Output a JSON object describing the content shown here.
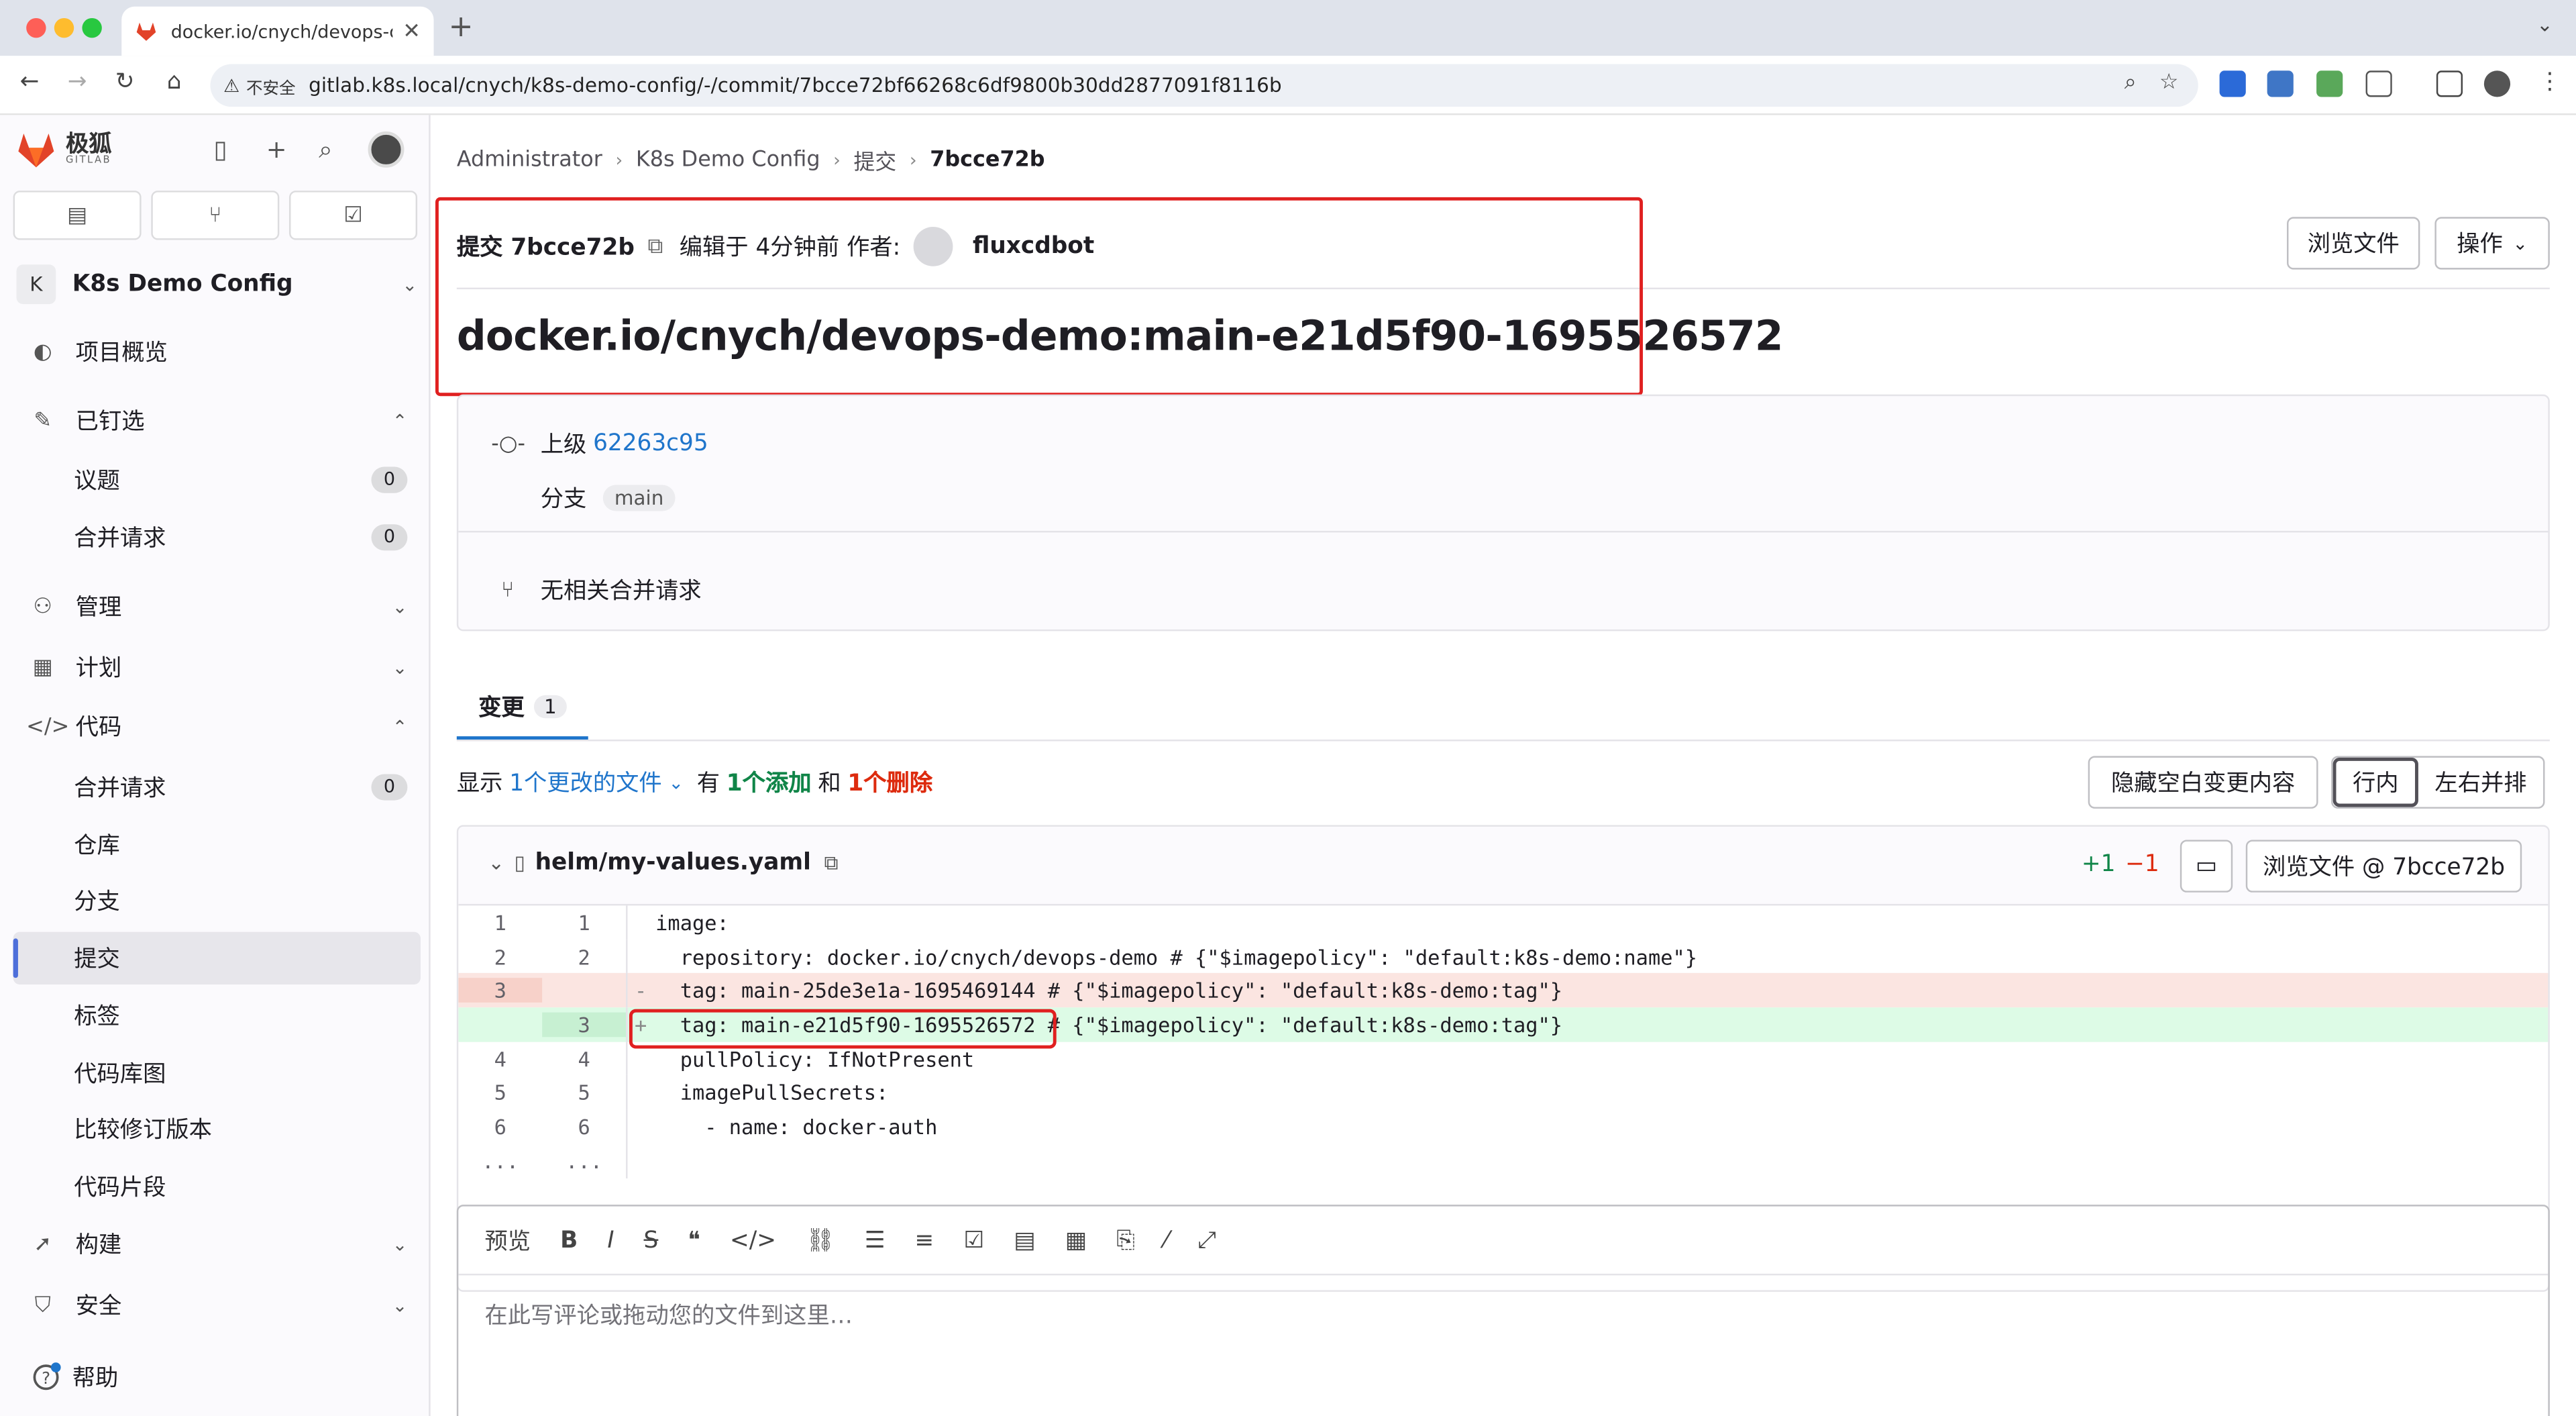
{
  "browser": {
    "tab_title": "docker.io/cnych/devops-dem",
    "security_label": "不安全",
    "url": "gitlab.k8s.local/cnych/k8s-demo-config/-/commit/7bcce72bf66268c6df9800b30dd2877091f8116b"
  },
  "sidebar": {
    "brand": "极狐",
    "brand_sub": "GITLAB",
    "project_initial": "K",
    "project_name": "K8s Demo Config",
    "items": [
      {
        "label": "项目概览"
      },
      {
        "label": "已钉选"
      },
      {
        "label": "议题",
        "count": "0"
      },
      {
        "label": "合并请求",
        "count": "0"
      },
      {
        "label": "管理"
      },
      {
        "label": "计划"
      },
      {
        "label": "代码"
      },
      {
        "label": "合并请求",
        "count": "0"
      },
      {
        "label": "仓库"
      },
      {
        "label": "分支"
      },
      {
        "label": "提交"
      },
      {
        "label": "标签"
      },
      {
        "label": "代码库图"
      },
      {
        "label": "比较修订版本"
      },
      {
        "label": "代码片段"
      },
      {
        "label": "构建"
      },
      {
        "label": "安全"
      }
    ],
    "help": "帮助"
  },
  "breadcrumb": [
    "Administrator",
    "K8s Demo Config",
    "提交",
    "7bcce72b"
  ],
  "commit": {
    "label": "提交 7bcce72b",
    "authored": "编辑于 4分钟前 作者:",
    "author": "fluxcdbot",
    "title": "docker.io/cnych/devops-demo:main-e21d5f90-1695526572",
    "parent_label": "上级",
    "parent_sha": "62263c95",
    "branch_label": "分支",
    "branch": "main",
    "no_mr": "无相关合并请求"
  },
  "buttons": {
    "browse_files": "浏览文件",
    "actions": "操作",
    "hide_whitespace": "隐藏空白变更内容",
    "inline": "行内",
    "side_by_side": "左右并排",
    "view_file": "浏览文件 @ 7bcce72b"
  },
  "changes_tab": {
    "label": "变更",
    "count": "1"
  },
  "summary": {
    "show": "显示",
    "files": "1个更改的文件",
    "has": "有",
    "additions": "1个添加",
    "and": "和",
    "deletions": "1个删除"
  },
  "diff": {
    "filename": "helm/my-values.yaml",
    "added": "+1",
    "removed": "−1",
    "lines": [
      {
        "old": "1",
        "new": "1",
        "type": "ctx",
        "text": "image:"
      },
      {
        "old": "2",
        "new": "2",
        "type": "ctx",
        "text": "  repository: docker.io/cnych/devops-demo # {\"$imagepolicy\": \"default:k8s-demo:name\"}"
      },
      {
        "old": "3",
        "new": "",
        "type": "del",
        "text": "  tag: main-25de3e1a-1695469144 # {\"$imagepolicy\": \"default:k8s-demo:tag\"}"
      },
      {
        "old": "",
        "new": "3",
        "type": "add",
        "text": "  tag: main-e21d5f90-1695526572 # {\"$imagepolicy\": \"default:k8s-demo:tag\"}"
      },
      {
        "old": "4",
        "new": "4",
        "type": "ctx",
        "text": "  pullPolicy: IfNotPresent"
      },
      {
        "old": "5",
        "new": "5",
        "type": "ctx",
        "text": "  imagePullSecrets:"
      },
      {
        "old": "6",
        "new": "6",
        "type": "ctx",
        "text": "    - name: docker-auth"
      },
      {
        "old": "...",
        "new": "...",
        "type": "ctx",
        "text": ""
      }
    ]
  },
  "editor": {
    "preview": "预览",
    "placeholder": "在此写评论或拖动您的文件到这里…"
  }
}
